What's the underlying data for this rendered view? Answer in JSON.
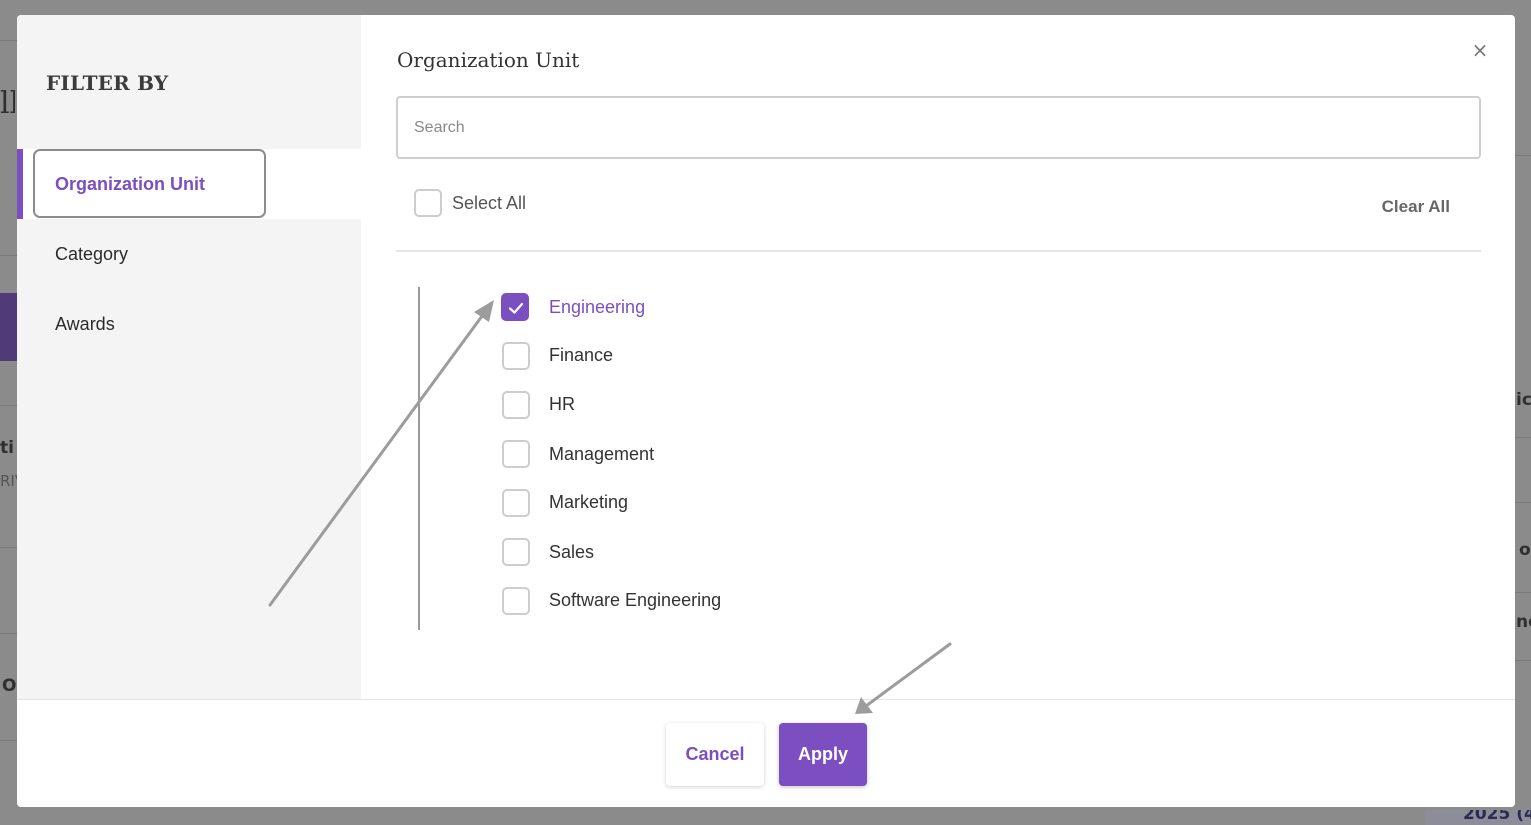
{
  "colors": {
    "accent": "#7b4fbf",
    "backdrop": "#8b8b8b"
  },
  "sidebar": {
    "title": "FILTER BY",
    "items": [
      {
        "label": "Organization Unit",
        "active": true
      },
      {
        "label": "Category",
        "active": false
      },
      {
        "label": "Awards",
        "active": false
      }
    ]
  },
  "content": {
    "title": "Organization Unit",
    "close_icon": "×",
    "search": {
      "placeholder": "Search",
      "value": ""
    },
    "select_all_label": "Select All",
    "clear_all_label": "Clear All",
    "options": [
      {
        "label": "Engineering",
        "checked": true
      },
      {
        "label": "Finance",
        "checked": false
      },
      {
        "label": "HR",
        "checked": false
      },
      {
        "label": "Management",
        "checked": false
      },
      {
        "label": "Marketing",
        "checked": false
      },
      {
        "label": "Sales",
        "checked": false
      },
      {
        "label": "Software Engineering",
        "checked": false
      }
    ]
  },
  "footer": {
    "cancel_label": "Cancel",
    "apply_label": "Apply"
  },
  "background_fragments": [
    "ll",
    "ti",
    "RIV",
    "O",
    "ic",
    "o",
    "ne",
    "2025 (4"
  ]
}
